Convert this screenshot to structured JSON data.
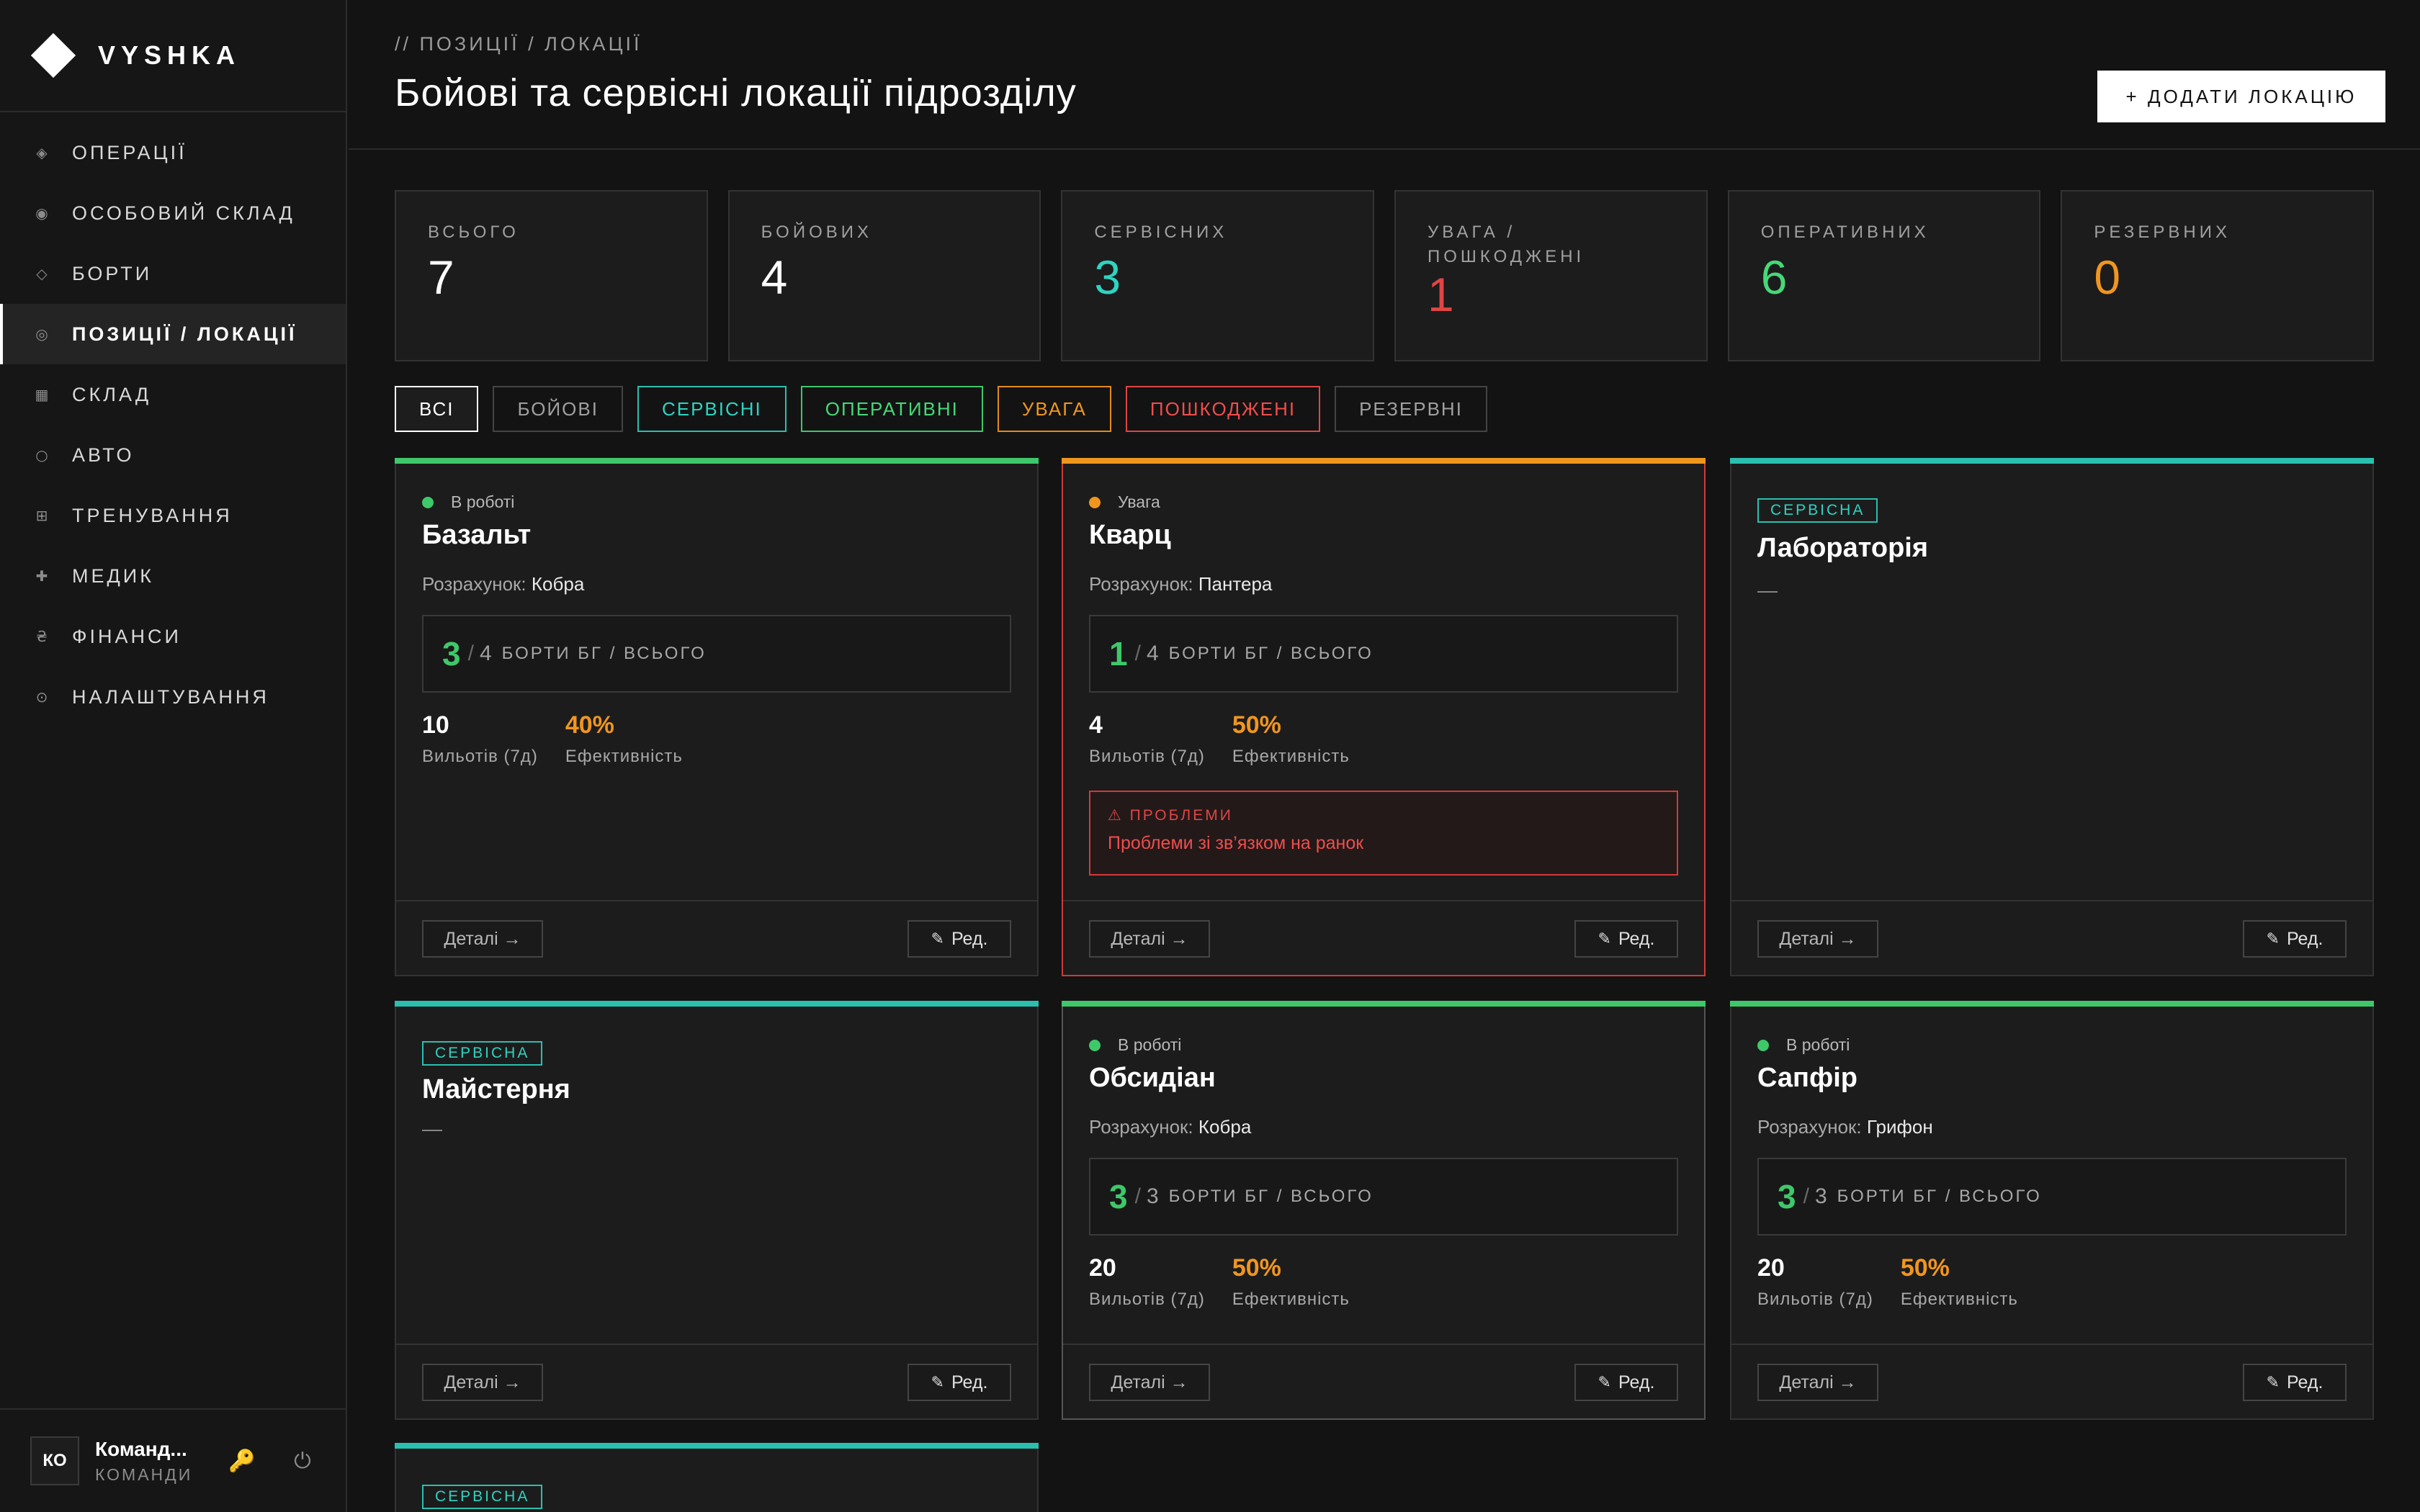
{
  "app": {
    "logo": "VYSHKA"
  },
  "sidebar": {
    "items": [
      {
        "icon": "◈",
        "label": "ОПЕРАЦІЇ"
      },
      {
        "icon": "◉",
        "label": "ОСОБОВИЙ СКЛАД"
      },
      {
        "icon": "◇",
        "label": "БОРТИ"
      },
      {
        "icon": "◎",
        "label": "ПОЗИЦІЇ / ЛОКАЦІЇ"
      },
      {
        "icon": "▦",
        "label": "СКЛАД"
      },
      {
        "icon": "○",
        "label": "АВТО"
      },
      {
        "icon": "⊞",
        "label": "ТРЕНУВАННЯ"
      },
      {
        "icon": "✚",
        "label": "МЕДИК"
      },
      {
        "icon": "₴",
        "label": "ФІНАНСИ"
      },
      {
        "icon": "⊙",
        "label": "НАЛАШТУВАННЯ"
      }
    ],
    "user": {
      "initials": "КО",
      "name": "Команд...",
      "role": "КОМАНДИ",
      "key_icon": "🔑",
      "power_icon": "⏻"
    }
  },
  "header": {
    "breadcrumb": "// ПОЗИЦІЇ / ЛОКАЦІЇ",
    "title": "Бойові та сервісні локації підрозділу",
    "add_button": "+ ДОДАТИ ЛОКАЦІЮ"
  },
  "stats": [
    {
      "label": "ВСЬОГО",
      "value": "7",
      "color": "#ffffff"
    },
    {
      "label": "БОЙОВИХ",
      "value": "4",
      "color": "#ffffff"
    },
    {
      "label": "СЕРВІСНИХ",
      "value": "3",
      "color": "#2fd3c2"
    },
    {
      "label": "УВАГА / ПОШКОДЖЕНІ",
      "value": "1",
      "color": "#e04545"
    },
    {
      "label": "ОПЕРАТИВНИХ",
      "value": "6",
      "color": "#46d878"
    },
    {
      "label": "РЕЗЕРВНИХ",
      "value": "0",
      "color": "#f0961f"
    }
  ],
  "filters": [
    "ВСІ",
    "БОЙОВІ",
    "СЕРВІСНІ",
    "ОПЕРАТИВНІ",
    "УВАГА",
    "ПОШКОДЖЕНІ",
    "РЕЗЕРВНІ"
  ],
  "colors": {
    "green": "#3ec86a",
    "orange": "#f0961f",
    "teal": "#2bbfb0",
    "red": "#d23a3a"
  },
  "cards": [
    {
      "status": "В роботі",
      "title": "Базальт",
      "calc_label": "Розрахунок:",
      "calc_value": "Кобра",
      "boards_bg": "3",
      "boards_total": "4",
      "boards_label": "БОРТИ БГ / ВСЬОГО",
      "flights": "10",
      "flights_label": "Вильотів (7д)",
      "efficiency": "40%",
      "efficiency_label": "Ефективність",
      "details": "Деталі →",
      "edit": "Ред."
    },
    {
      "status": "Увага",
      "title": "Кварц",
      "calc_label": "Розрахунок:",
      "calc_value": "Пантера",
      "boards_bg": "1",
      "boards_total": "4",
      "boards_label": "БОРТИ БГ / ВСЬОГО",
      "flights": "4",
      "flights_label": "Вильотів (7д)",
      "efficiency": "50%",
      "efficiency_label": "Ефективність",
      "problem_head": "⚠ ПРОБЛЕМИ",
      "problem_text": "Проблеми зі зв’язком на ранок",
      "details": "Деталі →",
      "edit": "Ред."
    },
    {
      "tag": "СЕРВІСНА",
      "title": "Лабораторія",
      "dash": "—",
      "details": "Деталі →",
      "edit": "Ред."
    },
    {
      "tag": "СЕРВІСНА",
      "title": "Майстерня",
      "dash": "—",
      "details": "Деталі →",
      "edit": "Ред."
    },
    {
      "status": "В роботі",
      "title": "Обсидіан",
      "calc_label": "Розрахунок:",
      "calc_value": "Кобра",
      "boards_bg": "3",
      "boards_total": "3",
      "boards_label": "БОРТИ БГ / ВСЬОГО",
      "flights": "20",
      "flights_label": "Вильотів (7д)",
      "efficiency": "50%",
      "efficiency_label": "Ефективність",
      "details": "Деталі →",
      "edit": "Ред."
    },
    {
      "status": "В роботі",
      "title": "Сапфір",
      "calc_label": "Розрахунок:",
      "calc_value": "Грифон",
      "boards_bg": "3",
      "boards_total": "3",
      "boards_label": "БОРТИ БГ / ВСЬОГО",
      "flights": "20",
      "flights_label": "Вильотів (7д)",
      "efficiency": "50%",
      "efficiency_label": "Ефективність",
      "details": "Деталі →",
      "edit": "Ред."
    },
    {
      "tag": "СЕРВІСНА"
    }
  ]
}
